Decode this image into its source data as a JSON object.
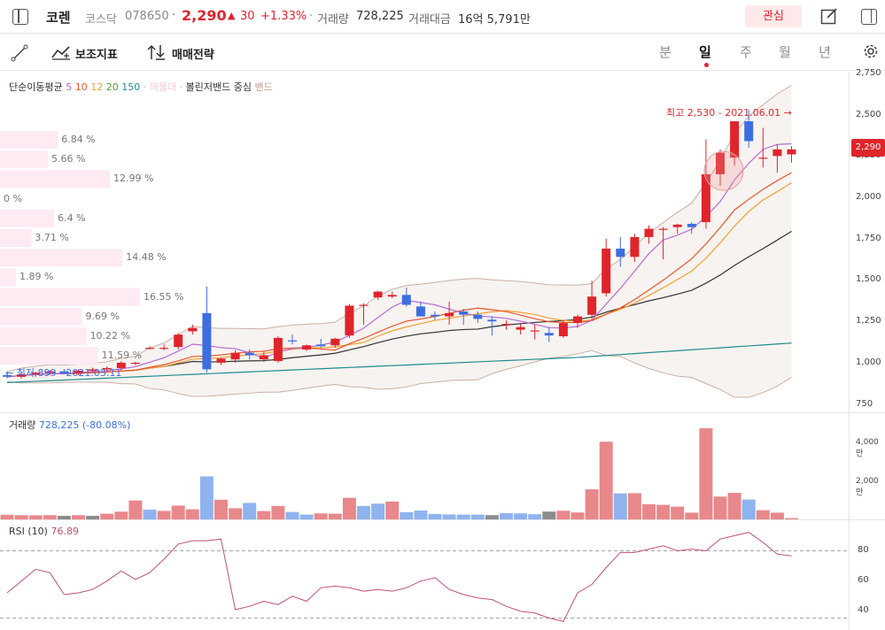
{
  "header": {
    "name": "코렌",
    "market": "코스닥",
    "code": "078650",
    "dot": "·",
    "price": "2,290",
    "change_arrow": "▲",
    "change": "30",
    "change_pct": "+1.33%",
    "volume_label": "거래량",
    "volume": "728,225",
    "amount_label": "거래대금",
    "amount": "16억 5,791만",
    "watch_label": "관심"
  },
  "toolbar": {
    "indicator_label": "보조지표",
    "strategy_label": "매매전략",
    "timeframes": [
      "분",
      "일",
      "주",
      "월",
      "년"
    ],
    "active_timeframe": "일"
  },
  "legend": {
    "sma_label": "단순이동평균",
    "sma_periods": [
      "5",
      "10",
      "12",
      "20",
      "150"
    ],
    "sma_colors": [
      "#b96bd8",
      "#e8562a",
      "#f0a030",
      "#333333",
      "#1f8c8c"
    ],
    "volume_ma": "매물대",
    "bb_label": "볼린저밴드",
    "bb_center": "중심",
    "bb_band": "밴드"
  },
  "annotations": {
    "high": "최고 2,530 - 2021.06.01 →",
    "low": "← 최저 899 - 2021.03.11",
    "current_price_tag": "2,290"
  },
  "price_axis": [
    "2,750",
    "2,500",
    "2,250",
    "2,000",
    "1,750",
    "1,500",
    "1,250",
    "1,000",
    "750"
  ],
  "volume_profile": [
    {
      "pct": "6.84 %"
    },
    {
      "pct": "5.66 %"
    },
    {
      "pct": "12.99 %"
    },
    {
      "pct": "0 %"
    },
    {
      "pct": "6.4 %"
    },
    {
      "pct": "3.71 %"
    },
    {
      "pct": "14.48 %"
    },
    {
      "pct": "1.89 %"
    },
    {
      "pct": "16.55 %"
    },
    {
      "pct": "9.69 %"
    },
    {
      "pct": "10.22 %"
    },
    {
      "pct": "11.59 %"
    }
  ],
  "volume_pane": {
    "label": "거래량",
    "value": "728,225 (-80.08%)",
    "axis": [
      "4,000만",
      "2,000만"
    ]
  },
  "rsi_pane": {
    "label": "RSI (10)",
    "value": "76.89",
    "axis": [
      "80",
      "60",
      "40"
    ]
  },
  "colors": {
    "up": "#e0242b",
    "down": "#3d6ee0",
    "accent_watch_bg": "#fde9ea",
    "bb_fill": "#f7f3f0"
  },
  "chart_data": {
    "type": "candlestick",
    "candles": [
      {
        "o": 925,
        "h": 935,
        "l": 905,
        "c": 915
      },
      {
        "o": 915,
        "h": 940,
        "l": 905,
        "c": 930
      },
      {
        "o": 930,
        "h": 945,
        "l": 915,
        "c": 940
      },
      {
        "o": 940,
        "h": 955,
        "l": 925,
        "c": 948
      },
      {
        "o": 948,
        "h": 962,
        "l": 930,
        "c": 935
      },
      {
        "o": 935,
        "h": 960,
        "l": 925,
        "c": 952
      },
      {
        "o": 952,
        "h": 970,
        "l": 940,
        "c": 960
      },
      {
        "o": 960,
        "h": 978,
        "l": 945,
        "c": 968
      },
      {
        "o": 968,
        "h": 1010,
        "l": 955,
        "c": 1000
      },
      {
        "o": 1000,
        "h": 1005,
        "l": 985,
        "c": 1000
      },
      {
        "o": 1090,
        "h": 1100,
        "l": 1080,
        "c": 1090
      },
      {
        "o": 1090,
        "h": 1110,
        "l": 1075,
        "c": 1090
      },
      {
        "o": 1095,
        "h": 1180,
        "l": 1080,
        "c": 1170
      },
      {
        "o": 1190,
        "h": 1230,
        "l": 1170,
        "c": 1210
      },
      {
        "o": 1300,
        "h": 1460,
        "l": 940,
        "c": 960
      },
      {
        "o": 1000,
        "h": 1030,
        "l": 985,
        "c": 1025
      },
      {
        "o": 1020,
        "h": 1075,
        "l": 1000,
        "c": 1060
      },
      {
        "o": 1060,
        "h": 1080,
        "l": 1020,
        "c": 1045
      },
      {
        "o": 1020,
        "h": 1070,
        "l": 1005,
        "c": 1045
      },
      {
        "o": 1010,
        "h": 1160,
        "l": 1000,
        "c": 1150
      },
      {
        "o": 1135,
        "h": 1170,
        "l": 1110,
        "c": 1130
      },
      {
        "o": 1080,
        "h": 1110,
        "l": 1070,
        "c": 1105
      },
      {
        "o": 1110,
        "h": 1145,
        "l": 1090,
        "c": 1100
      },
      {
        "o": 1105,
        "h": 1150,
        "l": 1090,
        "c": 1145
      },
      {
        "o": 1165,
        "h": 1355,
        "l": 1150,
        "c": 1345
      },
      {
        "o": 1345,
        "h": 1360,
        "l": 1230,
        "c": 1350
      },
      {
        "o": 1395,
        "h": 1435,
        "l": 1380,
        "c": 1430
      },
      {
        "o": 1400,
        "h": 1430,
        "l": 1390,
        "c": 1410
      },
      {
        "o": 1410,
        "h": 1455,
        "l": 1340,
        "c": 1350
      },
      {
        "o": 1340,
        "h": 1370,
        "l": 1300,
        "c": 1280
      },
      {
        "o": 1290,
        "h": 1310,
        "l": 1260,
        "c": 1280
      },
      {
        "o": 1280,
        "h": 1370,
        "l": 1230,
        "c": 1300
      },
      {
        "o": 1310,
        "h": 1325,
        "l": 1230,
        "c": 1290
      },
      {
        "o": 1290,
        "h": 1310,
        "l": 1240,
        "c": 1265
      },
      {
        "o": 1260,
        "h": 1280,
        "l": 1165,
        "c": 1250
      },
      {
        "o": 1235,
        "h": 1255,
        "l": 1200,
        "c": 1235
      },
      {
        "o": 1200,
        "h": 1240,
        "l": 1170,
        "c": 1215
      },
      {
        "o": 1190,
        "h": 1230,
        "l": 1140,
        "c": 1195
      },
      {
        "o": 1180,
        "h": 1215,
        "l": 1125,
        "c": 1165
      },
      {
        "o": 1160,
        "h": 1260,
        "l": 1150,
        "c": 1240
      },
      {
        "o": 1240,
        "h": 1290,
        "l": 1210,
        "c": 1280
      },
      {
        "o": 1290,
        "h": 1495,
        "l": 1260,
        "c": 1400
      },
      {
        "o": 1420,
        "h": 1750,
        "l": 1400,
        "c": 1690
      },
      {
        "o": 1690,
        "h": 1760,
        "l": 1580,
        "c": 1640
      },
      {
        "o": 1640,
        "h": 1780,
        "l": 1610,
        "c": 1760
      },
      {
        "o": 1760,
        "h": 1830,
        "l": 1720,
        "c": 1810
      },
      {
        "o": 1810,
        "h": 1820,
        "l": 1625,
        "c": 1810
      },
      {
        "o": 1820,
        "h": 1840,
        "l": 1780,
        "c": 1835
      },
      {
        "o": 1840,
        "h": 1850,
        "l": 1780,
        "c": 1820
      },
      {
        "o": 1850,
        "h": 2350,
        "l": 1810,
        "c": 2140
      },
      {
        "o": 2140,
        "h": 2290,
        "l": 2070,
        "c": 2270
      },
      {
        "o": 2240,
        "h": 2460,
        "l": 2190,
        "c": 2460
      },
      {
        "o": 2460,
        "h": 2530,
        "l": 2300,
        "c": 2340
      },
      {
        "o": 2240,
        "h": 2420,
        "l": 2180,
        "c": 2240
      },
      {
        "o": 2250,
        "h": 2320,
        "l": 2150,
        "c": 2290
      },
      {
        "o": 2260,
        "h": 2310,
        "l": 2210,
        "c": 2290
      }
    ],
    "volume": [
      {
        "v": 260,
        "up": true
      },
      {
        "v": 240,
        "up": true
      },
      {
        "v": 230,
        "up": true
      },
      {
        "v": 240,
        "up": true
      },
      {
        "v": 200,
        "up": false
      },
      {
        "v": 240,
        "up": true
      },
      {
        "v": 200,
        "up": false
      },
      {
        "v": 320,
        "up": true
      },
      {
        "v": 440,
        "up": true
      },
      {
        "v": 1070,
        "up": true
      },
      {
        "v": 550,
        "up": false
      },
      {
        "v": 480,
        "up": true
      },
      {
        "v": 780,
        "up": true
      },
      {
        "v": 570,
        "up": true
      },
      {
        "v": 2430,
        "up": false
      },
      {
        "v": 1110,
        "up": true
      },
      {
        "v": 630,
        "up": true
      },
      {
        "v": 930,
        "up": false
      },
      {
        "v": 470,
        "up": true
      },
      {
        "v": 760,
        "up": true
      },
      {
        "v": 420,
        "up": false
      },
      {
        "v": 270,
        "up": false
      },
      {
        "v": 340,
        "up": true
      },
      {
        "v": 320,
        "up": true
      },
      {
        "v": 1220,
        "up": true
      },
      {
        "v": 760,
        "up": false
      },
      {
        "v": 890,
        "up": false
      },
      {
        "v": 1010,
        "up": true
      },
      {
        "v": 410,
        "up": false
      },
      {
        "v": 500,
        "up": false
      },
      {
        "v": 310,
        "up": false
      },
      {
        "v": 280,
        "up": false
      },
      {
        "v": 270,
        "up": false
      },
      {
        "v": 270,
        "up": false
      },
      {
        "v": 240,
        "up": false
      },
      {
        "v": 350,
        "up": false
      },
      {
        "v": 340,
        "up": false
      },
      {
        "v": 290,
        "up": false
      },
      {
        "v": 440,
        "up": false
      },
      {
        "v": 490,
        "up": true
      },
      {
        "v": 390,
        "up": true
      },
      {
        "v": 1700,
        "up": true
      },
      {
        "v": 4390,
        "up": true
      },
      {
        "v": 1470,
        "up": false
      },
      {
        "v": 1480,
        "up": true
      },
      {
        "v": 860,
        "up": true
      },
      {
        "v": 820,
        "up": true
      },
      {
        "v": 720,
        "up": true
      },
      {
        "v": 380,
        "up": true
      },
      {
        "v": 5150,
        "up": true
      },
      {
        "v": 1290,
        "up": true
      },
      {
        "v": 1500,
        "up": true
      },
      {
        "v": 1120,
        "up": false
      },
      {
        "v": 520,
        "up": true
      },
      {
        "v": 380,
        "up": true
      },
      {
        "v": 73,
        "up": true
      }
    ],
    "rsi": [
      55,
      62,
      69,
      67,
      54,
      55,
      57,
      62,
      68,
      63,
      67,
      75,
      84,
      86,
      86,
      87,
      45,
      47,
      50,
      48,
      53,
      50,
      58,
      59,
      58,
      56,
      57,
      56,
      58,
      62,
      64,
      57,
      54,
      52,
      51,
      47,
      44,
      43,
      40,
      38,
      55,
      60,
      70,
      79,
      79,
      81,
      83,
      80,
      81,
      80,
      87,
      89,
      91,
      85,
      78,
      77
    ],
    "ylim": [
      700,
      2760
    ],
    "rsi_ylim": [
      35,
      95
    ]
  }
}
